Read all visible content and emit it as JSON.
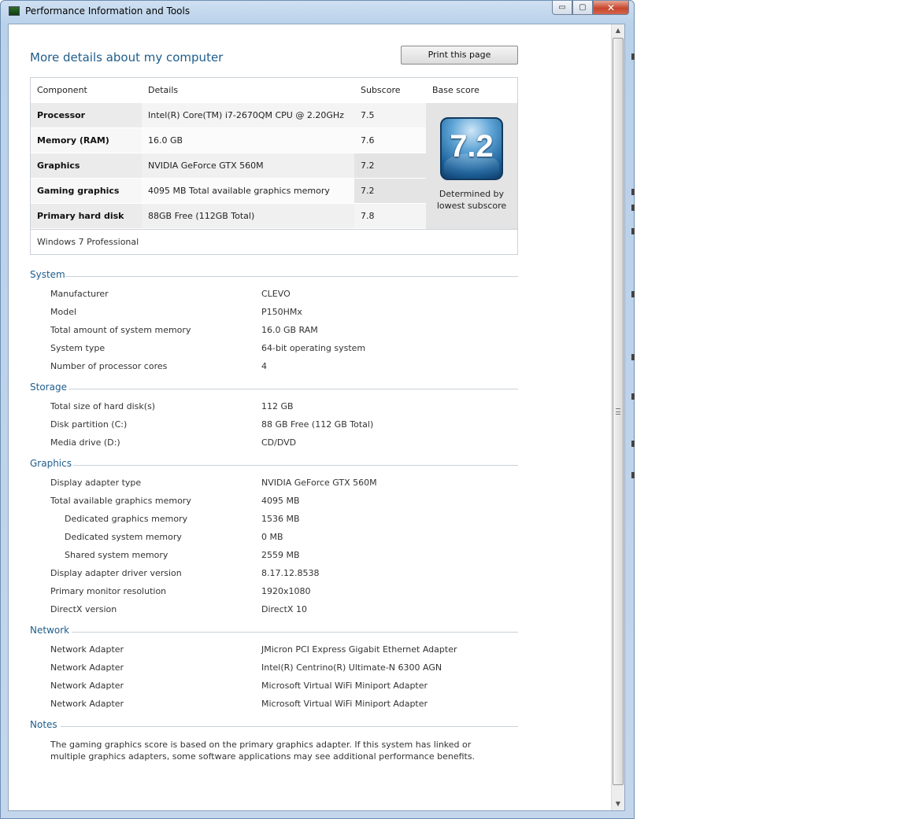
{
  "window": {
    "title": "Performance Information and Tools",
    "minimize": "▭",
    "maximize": "▢",
    "close": "✕"
  },
  "main": {
    "heading": "More details about my computer",
    "print_button": "Print this page"
  },
  "score_table": {
    "headers": {
      "component": "Component",
      "details": "Details",
      "subscore": "Subscore",
      "base_score": "Base score"
    },
    "rows": [
      {
        "component": "Processor",
        "details": "Intel(R) Core(TM) i7-2670QM CPU @ 2.20GHz",
        "subscore": "7.5"
      },
      {
        "component": "Memory (RAM)",
        "details": "16.0 GB",
        "subscore": "7.6"
      },
      {
        "component": "Graphics",
        "details": "NVIDIA GeForce GTX 560M",
        "subscore": "7.2"
      },
      {
        "component": "Gaming graphics",
        "details": "4095 MB Total available graphics memory",
        "subscore": "7.2"
      },
      {
        "component": "Primary hard disk",
        "details": "88GB Free (112GB Total)",
        "subscore": "7.8"
      }
    ],
    "base_score": "7.2",
    "base_note": "Determined by lowest subscore",
    "os": "Windows 7 Professional"
  },
  "sections": {
    "system": {
      "title": "System",
      "items": [
        {
          "label": "Manufacturer",
          "value": "CLEVO"
        },
        {
          "label": "Model",
          "value": "P150HMx"
        },
        {
          "label": "Total amount of system memory",
          "value": "16.0 GB RAM"
        },
        {
          "label": "System type",
          "value": "64-bit operating system"
        },
        {
          "label": "Number of processor cores",
          "value": "4"
        }
      ]
    },
    "storage": {
      "title": "Storage",
      "items": [
        {
          "label": "Total size of hard disk(s)",
          "value": "112 GB"
        },
        {
          "label": "Disk partition (C:)",
          "value": "88 GB Free (112 GB Total)"
        },
        {
          "label": "Media drive (D:)",
          "value": "CD/DVD"
        }
      ]
    },
    "graphics": {
      "title": "Graphics",
      "items": [
        {
          "label": "Display adapter type",
          "value": "NVIDIA GeForce GTX 560M"
        },
        {
          "label": "Total available graphics memory",
          "value": "4095 MB"
        },
        {
          "label": "Dedicated graphics memory",
          "value": "1536 MB"
        },
        {
          "label": "Dedicated system memory",
          "value": "0 MB"
        },
        {
          "label": "Shared system memory",
          "value": "2559 MB"
        },
        {
          "label": "Display adapter driver version",
          "value": "8.17.12.8538"
        },
        {
          "label": "Primary monitor resolution",
          "value": "1920x1080"
        },
        {
          "label": "DirectX version",
          "value": "DirectX 10"
        }
      ]
    },
    "network": {
      "title": "Network",
      "items": [
        {
          "label": "Network Adapter",
          "value": "JMicron PCI Express Gigabit Ethernet Adapter"
        },
        {
          "label": "Network Adapter",
          "value": "Intel(R) Centrino(R) Ultimate-N 6300 AGN"
        },
        {
          "label": "Network Adapter",
          "value": "Microsoft Virtual WiFi Miniport Adapter"
        },
        {
          "label": "Network Adapter",
          "value": "Microsoft Virtual WiFi Miniport Adapter"
        }
      ]
    },
    "notes": {
      "title": "Notes",
      "text": "The gaming graphics score is based on the primary graphics adapter. If this system has linked or multiple graphics adapters, some software applications may see additional performance benefits."
    }
  },
  "scrollbar": {
    "up": "▲",
    "down": "▼"
  },
  "colors": {
    "accent": "#1e5d8b",
    "row_shade": "#ebebeb",
    "base_cell": "#e4e4e4"
  }
}
